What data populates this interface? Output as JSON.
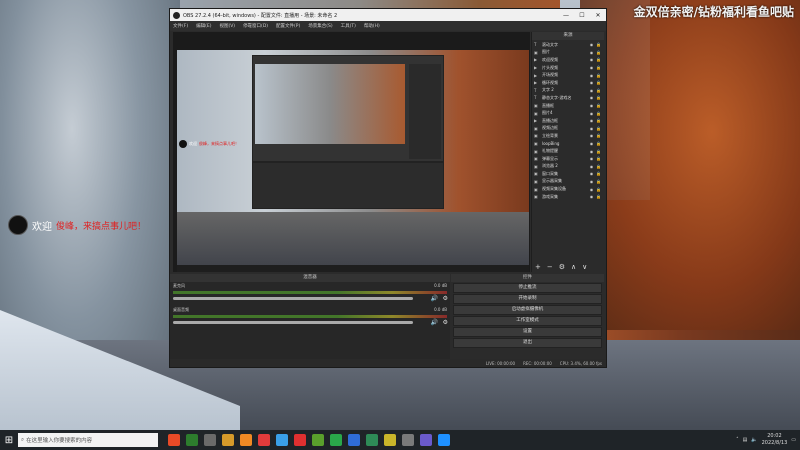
{
  "watermark": "金双倍亲密/钻粉福利看鱼吧贴",
  "desktop_overlay": {
    "welcome": "欢迎",
    "username": "俊峰，来搞点事儿吧！"
  },
  "window": {
    "title": "OBS 27.2.4 (64-bit, windows) - 配置文件: 直播用 - 场景: 未命名 2",
    "controls": [
      "—",
      "☐",
      "✕"
    ]
  },
  "menu": [
    "文件(F)",
    "编辑(E)",
    "视图(V)",
    "停靠窗口(D)",
    "配置文件(P)",
    "场景集合(S)",
    "工具(T)",
    "帮助(H)"
  ],
  "preview_overlay": {
    "welcome": "欢迎",
    "username": "俊峰，来搞点事儿吧！"
  },
  "sources": {
    "title": "来源",
    "items": [
      {
        "icon": "T",
        "name": "滚动文字"
      },
      {
        "icon": "▣",
        "name": "图片"
      },
      {
        "icon": "▶",
        "name": "欢迎视频"
      },
      {
        "icon": "▶",
        "name": "片头视频"
      },
      {
        "icon": "▶",
        "name": "开场视频"
      },
      {
        "icon": "▶",
        "name": "循环视频"
      },
      {
        "icon": "T",
        "name": "文字 2"
      },
      {
        "icon": "T",
        "name": "静态文字-游戏名"
      },
      {
        "icon": "▣",
        "name": "直播框"
      },
      {
        "icon": "▣",
        "name": "图片4"
      },
      {
        "icon": "▶",
        "name": "直播边框"
      },
      {
        "icon": "▣",
        "name": "视频边框"
      },
      {
        "icon": "▣",
        "name": "立绘背景"
      },
      {
        "icon": "▣",
        "name": "loopBing"
      },
      {
        "icon": "▣",
        "name": "礼物提醒"
      },
      {
        "icon": "▣",
        "name": "弹幕显示"
      },
      {
        "icon": "▣",
        "name": "浏览器 2"
      },
      {
        "icon": "▣",
        "name": "窗口采集"
      },
      {
        "icon": "▣",
        "name": "显示器采集"
      },
      {
        "icon": "▣",
        "name": "视频采集设备"
      },
      {
        "icon": "▣",
        "name": "游戏采集"
      }
    ],
    "toolbar": [
      "+",
      "−",
      "⚙",
      "∧",
      "∨"
    ]
  },
  "mixer": {
    "title": "混音器",
    "channels": [
      {
        "name": "麦克风",
        "db": "0.0 dB"
      },
      {
        "name": "桌面音频",
        "db": "0.0 dB"
      }
    ]
  },
  "controls": {
    "title": "控件",
    "buttons": [
      "停止推流",
      "开始录制",
      "启动虚拟摄像机",
      "工作室模式",
      "设置",
      "退出"
    ]
  },
  "status": {
    "live": "LIVE: 00:00:00",
    "rec": "REC: 00:00:00",
    "cpu": "CPU: 3.4%, 60.00 fps"
  },
  "taskbar": {
    "search_placeholder": "在这里输入你要搜索的内容",
    "time": "20:02",
    "date": "2022/8/13",
    "app_colors": [
      "#e84a27",
      "#2d7d2d",
      "#6a6a6a",
      "#d69a2a",
      "#f08a24",
      "#e23b3b",
      "#3aa0e8",
      "#e03030",
      "#5aa02c",
      "#2aa84a",
      "#2f6cd6",
      "#2e8b57",
      "#c9b52a",
      "#7a7a7a",
      "#6a5acd",
      "#1e90ff"
    ]
  }
}
